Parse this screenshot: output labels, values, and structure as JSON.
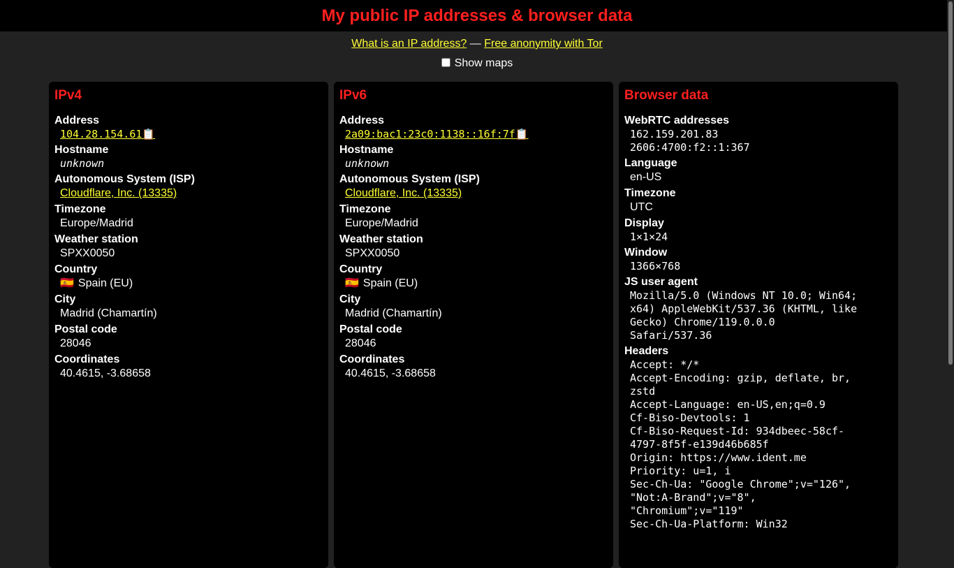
{
  "title": "My public IP addresses & browser data",
  "links": {
    "what_is_ip": "What is an IP address?",
    "separator": " — ",
    "tor": "Free anonymity with Tor"
  },
  "maps_toggle": {
    "label": "Show maps",
    "checked": false
  },
  "ipv4": {
    "heading": "IPv4",
    "address_label": "Address",
    "address": "104.28.154.61",
    "copy_icon": "clipboard-icon",
    "hostname_label": "Hostname",
    "hostname": "unknown",
    "isp_label": "Autonomous System (ISP)",
    "isp": "Cloudflare, Inc. (13335)",
    "timezone_label": "Timezone",
    "timezone": "Europe/Madrid",
    "weather_label": "Weather station",
    "weather": "SPXX0050",
    "country_label": "Country",
    "country_flag": "🇪🇸",
    "country": "Spain (EU)",
    "city_label": "City",
    "city": "Madrid (Chamartín)",
    "postal_label": "Postal code",
    "postal": "28046",
    "coords_label": "Coordinates",
    "coords": "40.4615, -3.68658"
  },
  "ipv6": {
    "heading": "IPv6",
    "address_label": "Address",
    "address": "2a09:bac1:23c0:1138::16f:7f",
    "copy_icon": "clipboard-icon",
    "hostname_label": "Hostname",
    "hostname": "unknown",
    "isp_label": "Autonomous System (ISP)",
    "isp": "Cloudflare, Inc. (13335)",
    "timezone_label": "Timezone",
    "timezone": "Europe/Madrid",
    "weather_label": "Weather station",
    "weather": "SPXX0050",
    "country_label": "Country",
    "country_flag": "🇪🇸",
    "country": "Spain (EU)",
    "city_label": "City",
    "city": "Madrid (Chamartín)",
    "postal_label": "Postal code",
    "postal": "28046",
    "coords_label": "Coordinates",
    "coords": "40.4615, -3.68658"
  },
  "browser": {
    "heading": "Browser data",
    "webrtc_label": "WebRTC addresses",
    "webrtc": [
      "162.159.201.83",
      "2606:4700:f2::1:367"
    ],
    "language_label": "Language",
    "language": "en-US",
    "timezone_label": "Timezone",
    "timezone": "UTC",
    "display_label": "Display",
    "display": "1×1×24",
    "window_label": "Window",
    "window": "1366×768",
    "ua_label": "JS user agent",
    "ua_lines": [
      "Mozilla/5.0 (Windows NT 10.0; Win64;",
      "x64) AppleWebKit/537.36 (KHTML, like",
      "Gecko) Chrome/119.0.0.0",
      "Safari/537.36"
    ],
    "headers_label": "Headers",
    "headers": [
      [
        "Accept: */*"
      ],
      [
        "Accept-Encoding: gzip, deflate, br,",
        "zstd"
      ],
      [
        "Accept-Language: en-US,en;q=0.9"
      ],
      [
        "Cf-Biso-Devtools: 1"
      ],
      [
        "Cf-Biso-Request-Id: 934dbeec-58cf-",
        "4797-8f5f-e139d46b685f"
      ],
      [
        "Origin: https://www.ident.me"
      ],
      [
        "Priority: u=1, i"
      ],
      [
        "Sec-Ch-Ua: \"Google Chrome\";v=\"126\",",
        "\"Not:A-Brand\";v=\"8\",",
        "\"Chromium\";v=\"119\""
      ],
      [
        "Sec-Ch-Ua-Platform: Win32"
      ]
    ]
  },
  "colors": {
    "accent_red": "#ff1f1f",
    "link_yellow": "#ffff33",
    "background": "#222222",
    "card": "#000000"
  }
}
